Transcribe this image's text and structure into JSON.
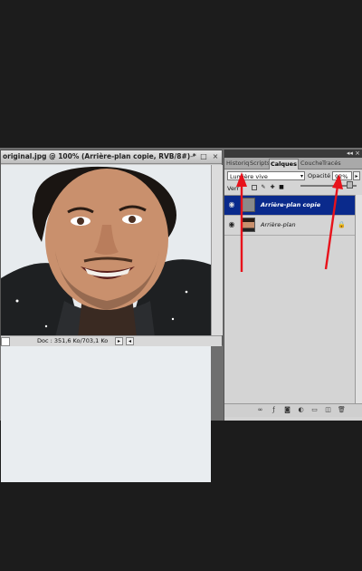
{
  "document": {
    "title": "original.jpg @ 100% (Arrière-plan copie, RVB/8#) *",
    "info": "Doc : 351,6 Ko/703,1 Ko"
  },
  "panel": {
    "tabs": [
      "Historiq",
      "Scripts",
      "Calques",
      "Couche",
      "Tracés"
    ],
    "active_tab": "Calques",
    "blend_mode": "Lumière vive",
    "opacity_label": "Opacité :",
    "opacity_value": "92%",
    "lock_label": "Verr",
    "layers": [
      {
        "name": "Arrière-plan copie",
        "selected": true
      },
      {
        "name": "Arrière-plan",
        "selected": false
      }
    ]
  },
  "colors": {
    "selection": "#0a2a8c",
    "annotation_arrow": "#e8121b"
  }
}
